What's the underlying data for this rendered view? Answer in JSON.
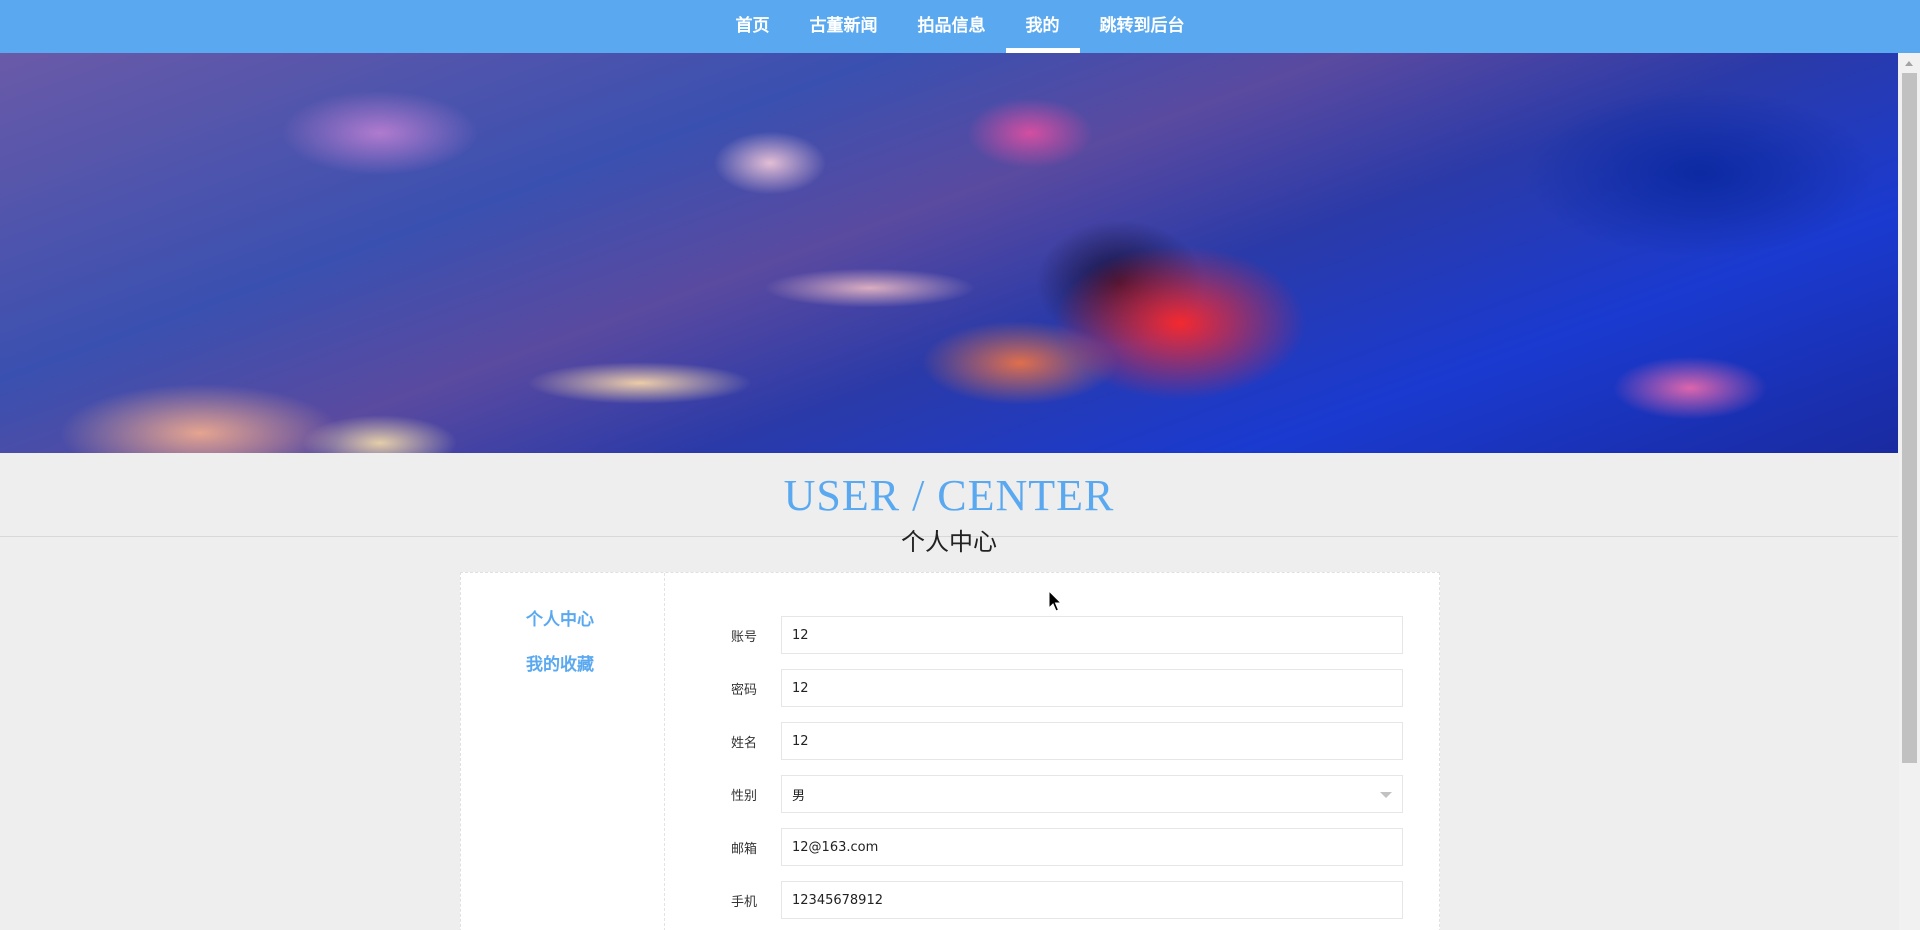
{
  "nav": {
    "items": [
      {
        "label": "首页",
        "active": false
      },
      {
        "label": "古董新闻",
        "active": false
      },
      {
        "label": "拍品信息",
        "active": false
      },
      {
        "label": "我的",
        "active": true
      },
      {
        "label": "跳转到后台",
        "active": false
      }
    ]
  },
  "section": {
    "title": "USER / CENTER",
    "subtitle": "个人中心"
  },
  "sidebar": {
    "items": [
      {
        "label": "个人中心"
      },
      {
        "label": "我的收藏"
      }
    ]
  },
  "form": {
    "account": {
      "label": "账号",
      "value": "12"
    },
    "password": {
      "label": "密码",
      "value": "12"
    },
    "name": {
      "label": "姓名",
      "value": "12"
    },
    "gender": {
      "label": "性别",
      "value": "男"
    },
    "email": {
      "label": "邮箱",
      "value": "12@163.com"
    },
    "phone": {
      "label": "手机",
      "value": "12345678912"
    }
  },
  "colors": {
    "accent": "#5aa9f0",
    "background": "#eeeeee"
  }
}
